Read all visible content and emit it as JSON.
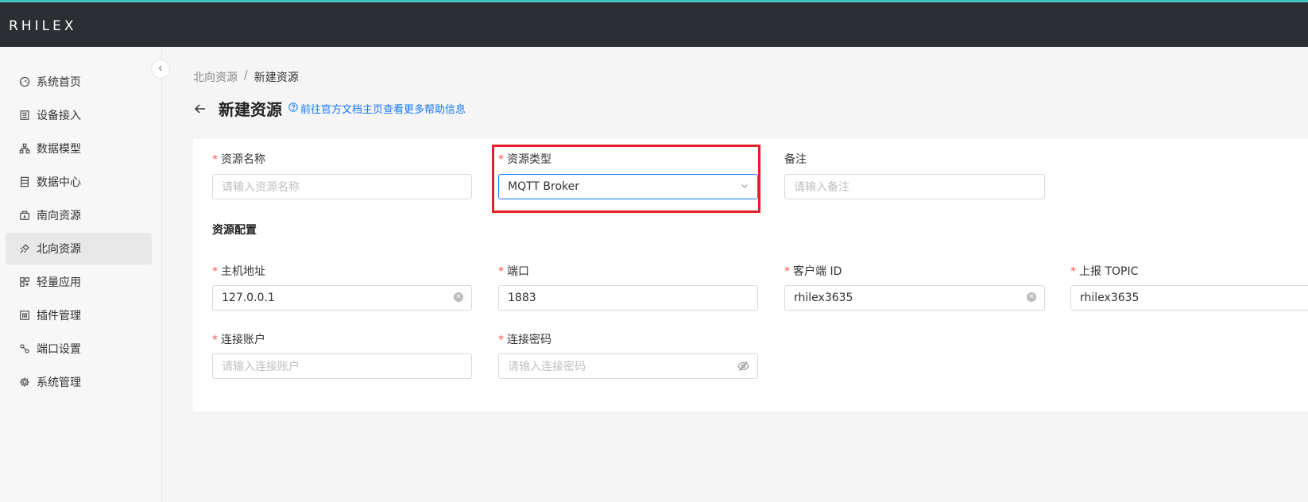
{
  "app": {
    "logo": "RHILEX"
  },
  "sidebar": {
    "items": [
      {
        "label": "系统首页",
        "icon": "dashboard-icon"
      },
      {
        "label": "设备接入",
        "icon": "device-icon"
      },
      {
        "label": "数据模型",
        "icon": "model-icon"
      },
      {
        "label": "数据中心",
        "icon": "database-icon"
      },
      {
        "label": "南向资源",
        "icon": "south-resource-icon"
      },
      {
        "label": "北向资源",
        "icon": "north-resource-icon",
        "active": true
      },
      {
        "label": "轻量应用",
        "icon": "app-icon"
      },
      {
        "label": "插件管理",
        "icon": "plugin-icon"
      },
      {
        "label": "端口设置",
        "icon": "port-icon"
      },
      {
        "label": "系统管理",
        "icon": "gear-icon"
      }
    ]
  },
  "breadcrumb": {
    "parent": "北向资源",
    "separator": "/",
    "current": "新建资源"
  },
  "page": {
    "title": "新建资源",
    "help_link": "前往官方文档主页查看更多帮助信息"
  },
  "form": {
    "name": {
      "label": "资源名称",
      "placeholder": "请输入资源名称",
      "required": true
    },
    "type": {
      "label": "资源类型",
      "value": "MQTT Broker",
      "required": true
    },
    "remark": {
      "label": "备注",
      "placeholder": "请输入备注"
    },
    "config_title": "资源配置",
    "host": {
      "label": "主机地址",
      "value": "127.0.0.1",
      "required": true
    },
    "port": {
      "label": "端口",
      "value": "1883",
      "required": true
    },
    "client_id": {
      "label": "客户端 ID",
      "value": "rhilex3635",
      "required": true
    },
    "topic": {
      "label": "上报 TOPIC",
      "value": "rhilex3635",
      "required": true
    },
    "username": {
      "label": "连接账户",
      "placeholder": "请输入连接账户",
      "required": true
    },
    "password": {
      "label": "连接密码",
      "placeholder": "请输入连接密码",
      "required": true
    }
  },
  "colors": {
    "accent": "#1677ff",
    "required": "#ff4d4f",
    "highlight": "#e5202a",
    "header": "#2b2f33"
  }
}
